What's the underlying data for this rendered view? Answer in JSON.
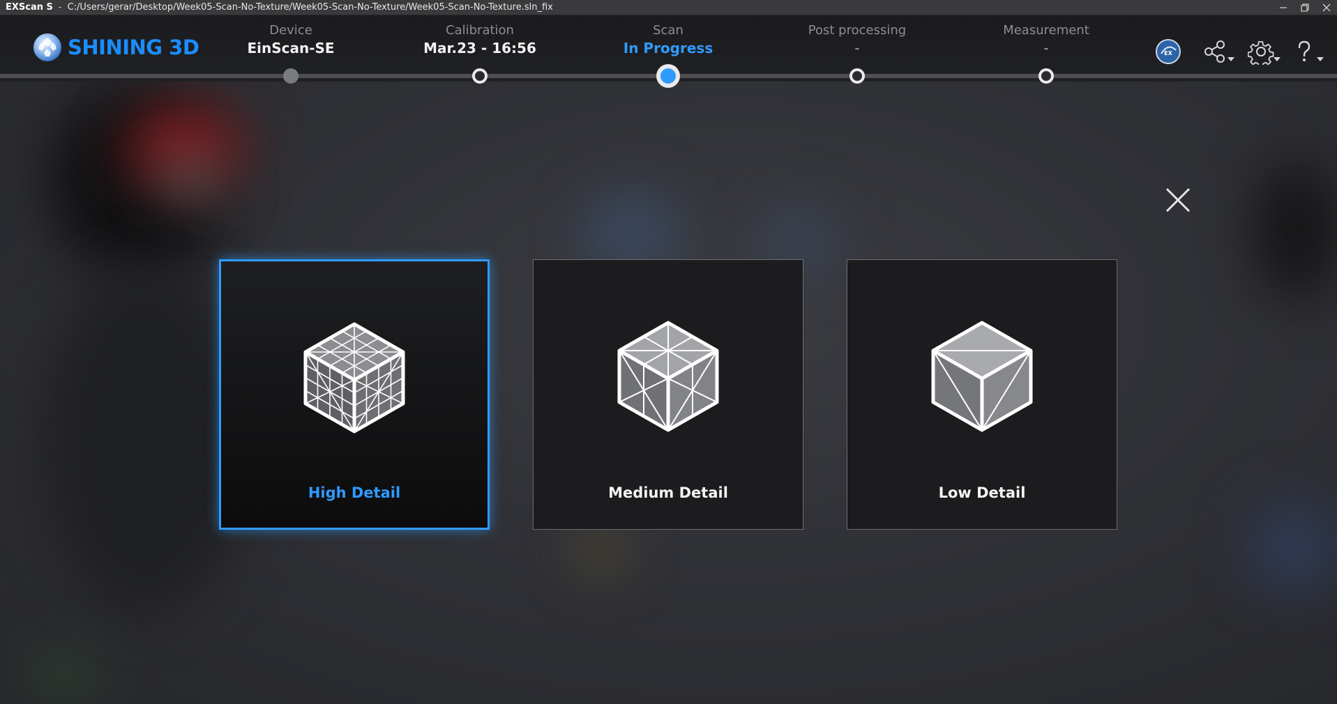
{
  "window": {
    "app_name": "EXScan S",
    "separator": "-",
    "file_path": "C:/Users/gerar/Desktop/Week05-Scan-No-Texture/Week05-Scan-No-Texture/Week05-Scan-No-Texture.sln_fix",
    "controls": [
      "minimize-icon",
      "restore-icon",
      "close-icon"
    ]
  },
  "brand": {
    "logo_text": "SHINING 3D",
    "color": "#1a8dff"
  },
  "workflow": {
    "steps": [
      {
        "label": "Device",
        "value": "EinScan-SE",
        "state": "done"
      },
      {
        "label": "Calibration",
        "value": "Mar.23 - 16:56",
        "state": "ring"
      },
      {
        "label": "Scan",
        "value": "In Progress",
        "state": "current"
      },
      {
        "label": "Post processing",
        "value": "-",
        "state": "ring"
      },
      {
        "label": "Measurement",
        "value": "-",
        "state": "ring"
      }
    ]
  },
  "toolbar": {
    "icons": [
      "exmodel-icon",
      "share-icon",
      "settings-icon",
      "help-icon"
    ]
  },
  "dialog": {
    "close_icon": "close-x-icon",
    "options": [
      {
        "label": "High Detail",
        "selected": true,
        "icon": "high-density-cube-icon"
      },
      {
        "label": "Medium Detail",
        "selected": false,
        "icon": "medium-density-cube-icon"
      },
      {
        "label": "Low Detail",
        "selected": false,
        "icon": "low-density-cube-icon"
      }
    ]
  },
  "colors": {
    "accent": "#2f9bff",
    "background": "#2b2c30",
    "card": "#1c1c1e"
  }
}
